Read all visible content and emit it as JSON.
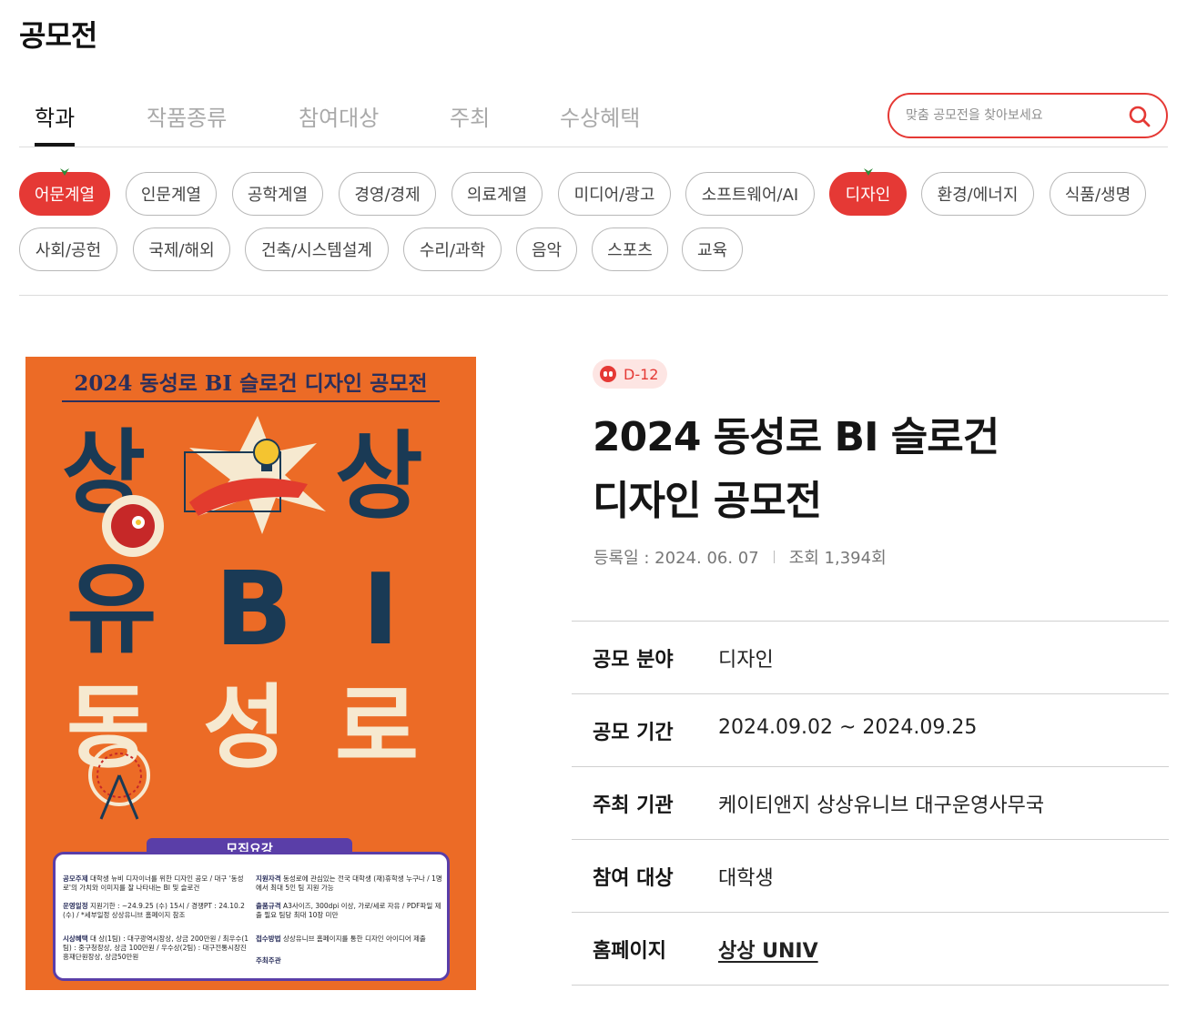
{
  "page": {
    "title": "공모전"
  },
  "tabs": [
    {
      "label": "학과",
      "active": true
    },
    {
      "label": "작품종류",
      "active": false
    },
    {
      "label": "참여대상",
      "active": false
    },
    {
      "label": "주최",
      "active": false
    },
    {
      "label": "수상혜택",
      "active": false
    }
  ],
  "search": {
    "placeholder": "맞춤 공모전을 찾아보세요",
    "value": "",
    "icon": "search-icon"
  },
  "chips": [
    {
      "label": "어문계열",
      "selected": true
    },
    {
      "label": "인문계열",
      "selected": false
    },
    {
      "label": "공학계열",
      "selected": false
    },
    {
      "label": "경영/경제",
      "selected": false
    },
    {
      "label": "의료계열",
      "selected": false
    },
    {
      "label": "미디어/광고",
      "selected": false
    },
    {
      "label": "소프트웨어/AI",
      "selected": false
    },
    {
      "label": "디자인",
      "selected": true
    },
    {
      "label": "환경/에너지",
      "selected": false
    },
    {
      "label": "식품/생명",
      "selected": false
    },
    {
      "label": "사회/공헌",
      "selected": false
    },
    {
      "label": "국제/해외",
      "selected": false
    },
    {
      "label": "건축/시스템설계",
      "selected": false
    },
    {
      "label": "수리/과학",
      "selected": false
    },
    {
      "label": "음악",
      "selected": false
    },
    {
      "label": "스포츠",
      "selected": false
    },
    {
      "label": "교육",
      "selected": false
    }
  ],
  "poster": {
    "title": "2024 동성로 BI 슬로건 디자인 공모전",
    "big_letters": [
      "상",
      "상",
      "유",
      "B",
      "I",
      "동",
      "성",
      "로"
    ],
    "recruit_heading": "모집요강",
    "rows": [
      {
        "label": "공모주제",
        "text": "대학생 뉴비 디자이너를 위한 디자인 공모 / 대구 '동성로'의 가치와 이미지를 잘 나타내는 BI 및 슬로건"
      },
      {
        "label": "운영일정",
        "text": "지원기한 : ~24.9.25 (수) 15시 / 경쟁PT : 24.10.2 (수) / *세부일정 상상유니브 홈페이지 참조"
      },
      {
        "label": "시상혜택",
        "text": "대 상(1팀) : 대구광역시장상, 상금 200만원 / 최우수(1팀) : 중구청장상, 상금 100만원 / 우수상(2팀) : 대구전통시장진흥재단원장상, 상금50만원"
      },
      {
        "label": "지원자격",
        "text": "동성로에 관심있는 전국 대학생 (재)휴학생 누구나 / 1명에서 최대 5인 팀 지원 가능"
      },
      {
        "label": "출품규격",
        "text": "A3사이즈, 300dpi 이상, 가로/세로 자유 / PDF파일 제출 필요 팀당 최대 10장 미만"
      },
      {
        "label": "접수방법",
        "text": "상상유니브 홈페이지를 통한 디자인 아이디어 제출"
      },
      {
        "label": "주최주관",
        "text": ""
      }
    ]
  },
  "detail": {
    "dday": "D-12",
    "title_line1": "2024 동성로 BI 슬로건",
    "title_line2": "디자인 공모전",
    "registered": "등록일 : 2024. 06. 07",
    "views": "조회 1,394회",
    "info": [
      {
        "label": "공모 분야",
        "value": "디자인"
      },
      {
        "label": "공모 기간",
        "value": "2024.09.02 ~ 2024.09.25"
      },
      {
        "label": "주최 기관",
        "value": "케이티앤지 상상유니브 대구운영사무국"
      },
      {
        "label": "참여 대상",
        "value": "대학생"
      },
      {
        "label": "홈페이지",
        "value": "상상 UNIV"
      }
    ]
  },
  "colors": {
    "accent": "#e53935",
    "poster_bg": "#ec6b26",
    "poster_navy": "#1a3a55",
    "poster_purple": "#5a3ea8"
  }
}
